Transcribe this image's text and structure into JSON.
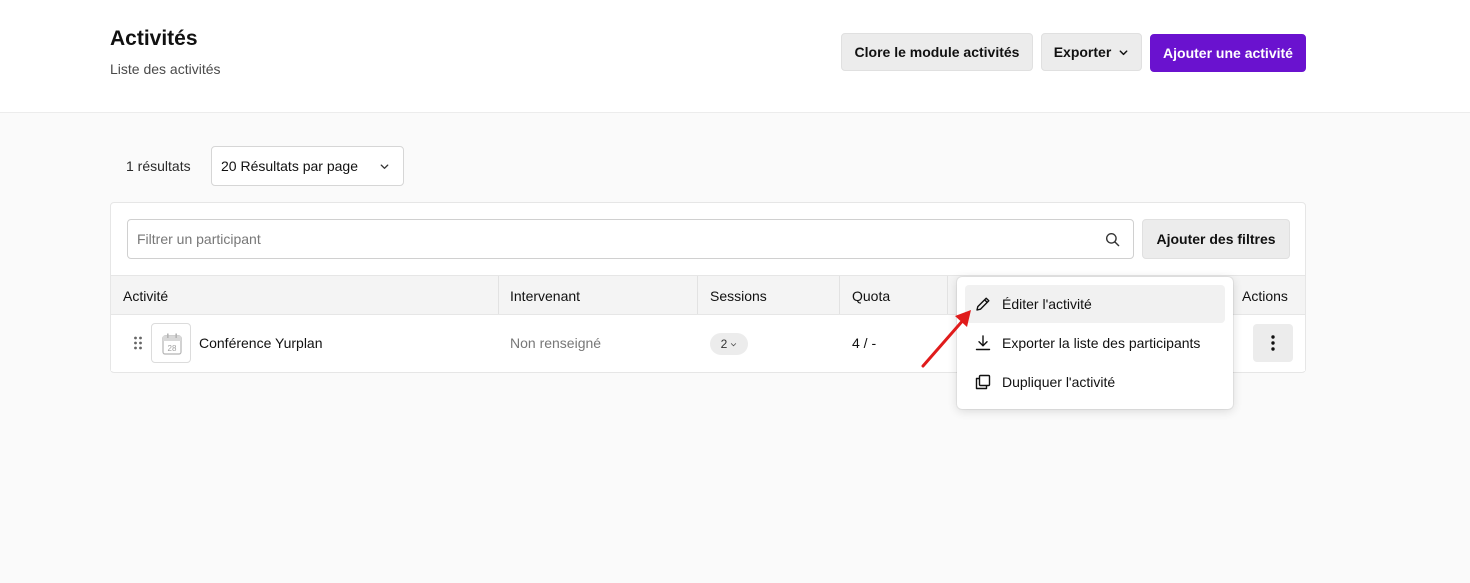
{
  "header": {
    "title": "Activités",
    "subtitle": "Liste des activités",
    "close_module_label": "Clore le module activités",
    "export_label": "Exporter",
    "add_activity_label": "Ajouter une activité"
  },
  "toolbar": {
    "results_count": "1 résultats",
    "per_page": "20 Résultats par page"
  },
  "search": {
    "placeholder": "Filtrer un participant",
    "add_filters_label": "Ajouter des filtres"
  },
  "table": {
    "columns": [
      "Activité",
      "Intervenant",
      "Sessions",
      "Quota",
      "Actions"
    ],
    "rows": [
      {
        "activity": "Conférence Yurplan",
        "calendar_day": "28",
        "speaker": "Non renseigné",
        "sessions": "2",
        "quota": "4 / -"
      }
    ]
  },
  "menu": {
    "items": [
      {
        "label": "Éditer l'activité",
        "icon": "pencil-icon"
      },
      {
        "label": "Exporter la liste des participants",
        "icon": "download-icon"
      },
      {
        "label": "Dupliquer l'activité",
        "icon": "duplicate-icon"
      }
    ]
  },
  "colors": {
    "primary": "#6a12cf",
    "annotation_arrow": "#e01b1b"
  }
}
